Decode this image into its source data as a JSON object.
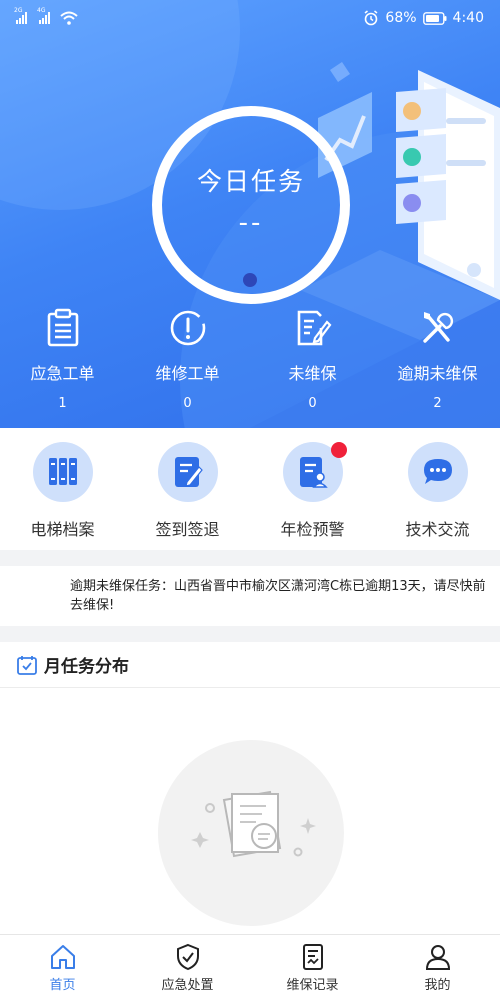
{
  "status_bar": {
    "signal_1": "2G",
    "signal_2": "4G",
    "battery": "68%",
    "time": "4:40"
  },
  "hero": {
    "ring_title": "今日任务",
    "ring_value": "--",
    "stats": [
      {
        "label": "应急工单",
        "count": "1",
        "icon": "clipboard-icon"
      },
      {
        "label": "维修工单",
        "count": "0",
        "icon": "alert-circle-icon"
      },
      {
        "label": "未维保",
        "count": "0",
        "icon": "edit-document-icon"
      },
      {
        "label": "逾期未维保",
        "count": "2",
        "icon": "tools-icon"
      }
    ]
  },
  "quick_menu": [
    {
      "label": "电梯档案",
      "icon": "archive-icon"
    },
    {
      "label": "签到签退",
      "icon": "sign-in-icon"
    },
    {
      "label": "年检预警",
      "icon": "inspection-icon",
      "badge": true
    },
    {
      "label": "技术交流",
      "icon": "chat-icon"
    }
  ],
  "notice": {
    "text": "逾期未维保任务：山西省晋中市榆次区潇河湾C栋已逾期13天，请尽快前去维保!"
  },
  "month_section": {
    "title": "月任务分布"
  },
  "tabs": [
    {
      "label": "首页",
      "icon": "home-icon",
      "active": true
    },
    {
      "label": "应急处置",
      "icon": "shield-check-icon"
    },
    {
      "label": "维保记录",
      "icon": "record-icon"
    },
    {
      "label": "我的",
      "icon": "user-icon"
    }
  ],
  "colors": {
    "accent": "#3a7ee8",
    "hero_start": "#5ea2ff",
    "hero_end": "#2f6eea",
    "badge": "#f0213a",
    "icon_bg": "#cfe0fb"
  }
}
